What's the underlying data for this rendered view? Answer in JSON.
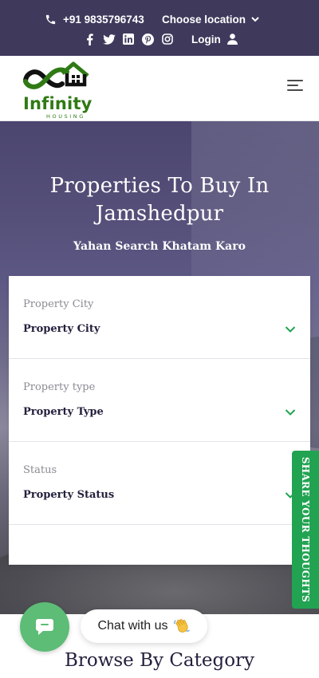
{
  "topbar": {
    "phone": "+91 9835796743",
    "location_label": "Choose location",
    "login_label": "Login",
    "socials": [
      "facebook-icon",
      "twitter-icon",
      "linkedin-icon",
      "pinterest-icon",
      "instagram-icon"
    ]
  },
  "header": {
    "logo_text": "Infinity",
    "logo_subtext": "HOUSING"
  },
  "hero": {
    "title": "Properties To Buy In Jamshedpur",
    "subtitle": "Yahan Search Khatam Karo"
  },
  "search_form": {
    "fields": [
      {
        "label": "Property City",
        "value": "Property City"
      },
      {
        "label": "Property type",
        "value": "Property Type"
      },
      {
        "label": "Status",
        "value": "Property Status"
      }
    ]
  },
  "share_tab": {
    "label": "SHARE YOUR THOUGHTS"
  },
  "chat": {
    "label": "Chat with us"
  },
  "section": {
    "title": "Browse By Category"
  },
  "colors": {
    "topbar": "#3f3a5c",
    "brand_green": "#2f7a14",
    "accent_green": "#22a352",
    "chat_green": "#5dbc76",
    "heading": "#23213d"
  }
}
